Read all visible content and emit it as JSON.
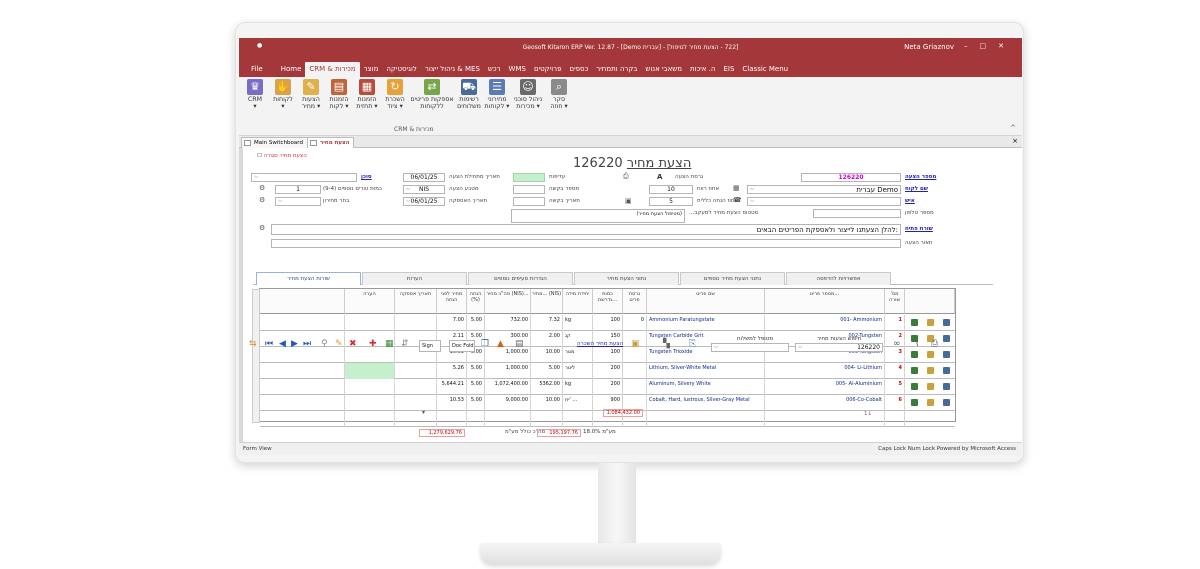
{
  "window": {
    "title": "Geosoft Kitaron ERP Ver. 12.87 - [Demo עברית] - [722 - הצעת מחיר לטיפול]",
    "user": "Neta Griaznov",
    "controls": [
      "–",
      "□",
      "✕"
    ]
  },
  "menu": {
    "items": [
      "File",
      "Home",
      "CRM & מכירות",
      "מוצר",
      "לוגיסטיקה",
      "ניהול ייצור & MES",
      "רכש",
      "WMS",
      "פרויקטים",
      "כספים",
      "בקרה ותמחיר",
      "משאבי אנוש",
      "ה. איכות",
      "EIS",
      "Classic Menu"
    ],
    "active": "CRM & מכירות"
  },
  "ribbon": {
    "buttons": [
      {
        "label": "CRM",
        "sub": "▾",
        "icon": "crm-icon",
        "color": "#7b6bc4"
      },
      {
        "label": "לקוחות",
        "sub": "▾",
        "icon": "handshake-icon",
        "color": "#d8a24a"
      },
      {
        "label": "הצעות",
        "sub": "מחיר ▾",
        "icon": "quote-icon",
        "color": "#e0b04a"
      },
      {
        "label": "הזמנות",
        "sub": "לקוח ▾",
        "icon": "order-icon",
        "color": "#c0643c"
      },
      {
        "label": "הזמנות",
        "sub": "תחזית ▾",
        "icon": "forecast-icon",
        "color": "#b84c3c"
      },
      {
        "label": "השכרת",
        "sub": "ציוד ▾",
        "icon": "rental-icon",
        "color": "#e8a13a"
      },
      {
        "label": "אספקות פריטים",
        "sub": "ללקוחות",
        "icon": "delivery-icon",
        "color": "#7aa44a"
      },
      {
        "label": "רשימות",
        "sub": "משלוחים",
        "icon": "truck-icon",
        "color": "#4a6a9a"
      },
      {
        "label": "מחירוני",
        "sub": "לקוחות ▾",
        "icon": "pricelist-icon",
        "color": "#5a7ab8"
      },
      {
        "label": "ניהול סוכני",
        "sub": "מכירות ▾",
        "icon": "agent-icon",
        "color": "#6a6a6a"
      },
      {
        "label": "סקר",
        "sub": "חוזה ▾",
        "icon": "survey-icon",
        "color": "#8a8a8a"
      }
    ],
    "group_label": "CRM & מכירות",
    "collapse": "^"
  },
  "doc_tabs": [
    "Main Switchboard",
    "הצעת מחיר"
  ],
  "form": {
    "title_prefix": "הצעת מחיר",
    "title_number": "126220",
    "closed_checkbox": "הצעת מחיר סגורה",
    "quote_no_label": "מספר הצעה",
    "quote_no": "126220",
    "customer_label": "שם לקוח",
    "customer": "עברית Demo",
    "contact_label": "איש",
    "phone_label": "מספר טלפון",
    "version_label": "גרסת הצעה",
    "version": "A",
    "duration_label": "אחוז רווח",
    "duration": "10",
    "discount_label": "אחוז הנחה כללית",
    "discount": "5",
    "status_label": "סטטוס הצעת מחיר למעקב...",
    "status_value": "(מטיפול הצעת מחיר)",
    "priority_label": "עדיפות",
    "req_no_label": "מספר בקשה",
    "req_date_label": "תאריך בקשה",
    "quote_date_label": "תאריך מתחילת הצעה",
    "quote_date": "06/01/25",
    "currency_label": "מטבע הצעה",
    "currency": "NIS",
    "valid_date_label": "תאריך האספקה",
    "valid_date": "06/01/25",
    "agent_label": "סוכן",
    "copies_label": "כמות טורים נוספים (9-4)",
    "copies": "1",
    "pricelist_label": "בחר מחירון",
    "opening_label": "שורת פתיח",
    "opening_text": "להלן הצעתנו לייצור ולאספקת הפריטים הבאים:",
    "desc_label": "תאור הצעה"
  },
  "sub_tabs": [
    "אפשרויות להדפסה",
    "נתוני הצעת מחיר נוספים",
    "נתוני הצעת מחיר",
    "הגדרות סעיפים נוספים",
    "הערות",
    "שורות הצעת מחיר"
  ],
  "grid": {
    "headers": [
      "מס' שורה",
      "מספר פריט...",
      "שם פריט",
      "גרסת פריט",
      "כמות נדרשת...",
      "יחידת מידה",
      "מחיר... (NIS)",
      "סה\"כ מחיר (NIS)...",
      "הנחה (%)",
      "מחיר לפני הנחה",
      "תאריך אספקה",
      "הערה"
    ],
    "rows": [
      {
        "n": "1",
        "code": "001- Ammonium",
        "name": "Ammonium Paratungstate",
        "ver": "0",
        "qty": "100",
        "unit": "kg",
        "price": "7.32",
        "total": "732.00",
        "disc": "5.00",
        "before": "7.00",
        "green": false
      },
      {
        "n": "2",
        "code": "002-Tungsten",
        "name": "Tungsten Carbide Grit",
        "ver": "",
        "qty": "150",
        "unit": "קג",
        "price": "2.00",
        "total": "300.00",
        "disc": "5.00",
        "before": "2.11",
        "green": false
      },
      {
        "n": "3",
        "code": "003-Tungsten",
        "name": "Tungsten Trioxide",
        "ver": "",
        "qty": "100",
        "unit": "מטר",
        "price": "10.00",
        "total": "1,000.00",
        "disc": "5.00",
        "before": "10.53",
        "green": false
      },
      {
        "n": "4",
        "code": "004- Li-Lithium",
        "name": "Lithium, Silver-White Metal",
        "ver": "",
        "qty": "200",
        "unit": "ליטר",
        "price": "5.00",
        "total": "1,000.00",
        "disc": "5.00",
        "before": "5.26",
        "green": true
      },
      {
        "n": "5",
        "code": "005- Al-Aluminium",
        "name": "Aluminum, Silvery White",
        "ver": "",
        "qty": "200",
        "unit": "kg",
        "price": "5362.00",
        "total": "1,072,400.00",
        "disc": "5.00",
        "before": "5,644.21",
        "green": false
      },
      {
        "n": "6",
        "code": "006-Co-Cobalt",
        "name": "Cobalt, Hard, lustrous, Silver-Gray Metal",
        "ver": "",
        "qty": "900",
        "unit": "יח' ...",
        "price": "10.00",
        "total": "9,000.00",
        "disc": "5.00",
        "before": "10.53",
        "green": false
      }
    ],
    "sum_total": "1,084,432.00",
    "row_count_label": "1↓"
  },
  "totals": {
    "net_label": "סה\"כ כולל מע\"מ",
    "net_value": "1,279,629.76",
    "vat_label": "מע\"מ",
    "vat_pct": "18.0%",
    "vat_value": "195,197.76"
  },
  "footer": {
    "sign_label": "Sign",
    "doc_label": "Doc Fold",
    "quote_link": "הצעת מחיר השכרה",
    "handled_label": "מטופל למשלוח",
    "search_label": "חיפוש הצעות מחיר",
    "search_value": "126220"
  },
  "status": {
    "left": "Form View",
    "right": "Caps Lock   Num Lock   Powered by Microsoft Access"
  },
  "colors": {
    "brand": "#a4373a",
    "link": "#2222aa",
    "green": "#c6efce"
  }
}
